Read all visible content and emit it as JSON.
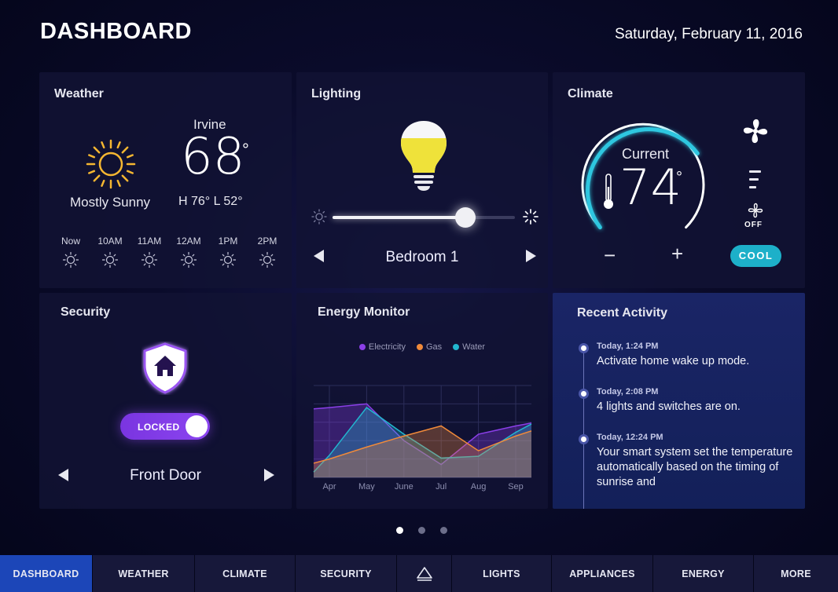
{
  "header": {
    "title": "DASHBOARD",
    "date": "Saturday, February 11, 2016"
  },
  "weather": {
    "title": "Weather",
    "city": "Irvine",
    "temp": "68",
    "deg": "°",
    "condition": "Mostly Sunny",
    "hilo": "H 76°  L 52°",
    "hours": [
      "Now",
      "10AM",
      "11AM",
      "12AM",
      "1PM",
      "2PM"
    ]
  },
  "lighting": {
    "title": "Lighting",
    "room": "Bedroom 1",
    "brightness": 0.73
  },
  "climate": {
    "title": "Climate",
    "current_label": "Current",
    "temp": "74",
    "deg": "°",
    "fan_state": "OFF",
    "mode": "COOL",
    "minus": "−",
    "plus": "+"
  },
  "security": {
    "title": "Security",
    "lock_state": "LOCKED",
    "door": "Front Door"
  },
  "energy": {
    "title": "Energy Monitor",
    "legend": [
      {
        "name": "Electricity",
        "color": "#8b3fe8"
      },
      {
        "name": "Gas",
        "color": "#f08a3a"
      },
      {
        "name": "Water",
        "color": "#22b6cf"
      }
    ]
  },
  "chart_data": {
    "type": "area",
    "categories": [
      "Apr",
      "May",
      "June",
      "Jul",
      "Aug",
      "Sep"
    ],
    "series": [
      {
        "name": "Electricity",
        "values": [
          76,
          80,
          40,
          14,
          47,
          56
        ]
      },
      {
        "name": "Gas",
        "values": [
          20,
          33,
          45,
          56,
          29,
          45
        ]
      },
      {
        "name": "Water",
        "values": [
          24,
          76,
          47,
          21,
          23,
          49
        ]
      }
    ],
    "ylim": [
      0,
      100
    ]
  },
  "activity": {
    "title": "Recent Activity",
    "items": [
      {
        "time": "Today, 1:24 PM",
        "text": "Activate home wake up mode."
      },
      {
        "time": "Today, 2:08 PM",
        "text": "4 lights and switches are on."
      },
      {
        "time": "Today, 12:24 PM",
        "text": "Your smart system set the temperature automatically based on the timing of sunrise and"
      }
    ]
  },
  "pagination": {
    "count": 3,
    "active": 0
  },
  "nav": {
    "items": [
      "DASHBOARD",
      "WEATHER",
      "CLIMATE",
      "SECURITY",
      "",
      "LIGHTS",
      "APPLIANCES",
      "ENERGY",
      "MORE"
    ],
    "home_icon": "triangle-home-icon"
  }
}
